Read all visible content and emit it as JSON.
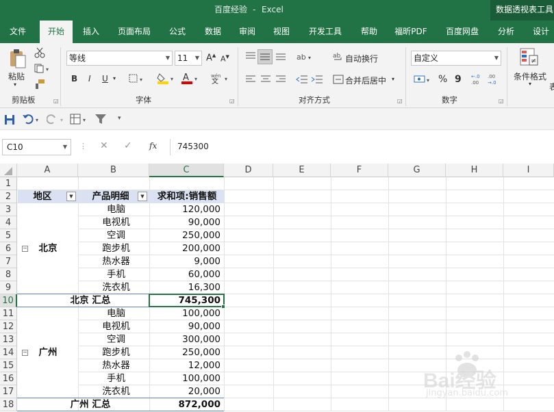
{
  "title": {
    "doc": "百度经验",
    "sep": "-",
    "app": "Excel",
    "context_tools": "数据透视表工具"
  },
  "tabs": [
    "文件",
    "开始",
    "插入",
    "页面布局",
    "公式",
    "数据",
    "审阅",
    "视图",
    "开发工具",
    "帮助",
    "福昕PDF",
    "百度网盘",
    "分析",
    "设计"
  ],
  "ribbon": {
    "clipboard": {
      "paste": "粘贴",
      "label": "剪贴板"
    },
    "font": {
      "name": "等线",
      "size": "11",
      "grow": "A",
      "shrink": "A",
      "bold": "B",
      "italic": "I",
      "underline": "U",
      "label": "字体"
    },
    "alignment": {
      "wrap": "自动换行",
      "merge": "合并后居中",
      "label": "对齐方式"
    },
    "number": {
      "format": "自定义",
      "percent": "%",
      "comma": "9",
      "label": "数字"
    },
    "styles": {
      "conditional": "条件格式",
      "cut_off": "表"
    }
  },
  "formula_bar": {
    "name_box": "C10",
    "fx": "fx",
    "value": "745300"
  },
  "columns": [
    "A",
    "B",
    "C",
    "D",
    "E",
    "F",
    "G",
    "H",
    "I"
  ],
  "selected_column": "C",
  "selected_row": "10",
  "rows": [
    "1",
    "2",
    "3",
    "4",
    "5",
    "6",
    "7",
    "8",
    "9",
    "10",
    "11",
    "12",
    "13",
    "14",
    "15",
    "16",
    "17",
    "18"
  ],
  "pivot": {
    "headers": {
      "region": "地区",
      "product": "产品明细",
      "sum": "求和项:销售额"
    },
    "groups": [
      {
        "region": "北京",
        "items": [
          {
            "product": "电脑",
            "value": "120,000"
          },
          {
            "product": "电视机",
            "value": "90,000"
          },
          {
            "product": "空调",
            "value": "250,000"
          },
          {
            "product": "跑步机",
            "value": "200,000"
          },
          {
            "product": "热水器",
            "value": "9,000"
          },
          {
            "product": "手机",
            "value": "60,000"
          },
          {
            "product": "洗衣机",
            "value": "16,300"
          }
        ],
        "total_label": "北京 汇总",
        "total": "745,300"
      },
      {
        "region": "广州",
        "items": [
          {
            "product": "电脑",
            "value": "100,000"
          },
          {
            "product": "电视机",
            "value": "90,000"
          },
          {
            "product": "空调",
            "value": "300,000"
          },
          {
            "product": "跑步机",
            "value": "250,000"
          },
          {
            "product": "热水器",
            "value": "12,000"
          },
          {
            "product": "手机",
            "value": "100,000"
          },
          {
            "product": "洗衣机",
            "value": "20,000"
          }
        ],
        "total_label": "广州 汇总",
        "total": "872,000"
      }
    ]
  },
  "watermark": {
    "main": "Bai经验",
    "sub": "jingyan.baidu.com"
  },
  "colors": {
    "excel_green": "#217346",
    "header_fill": "#d9e1f2"
  }
}
